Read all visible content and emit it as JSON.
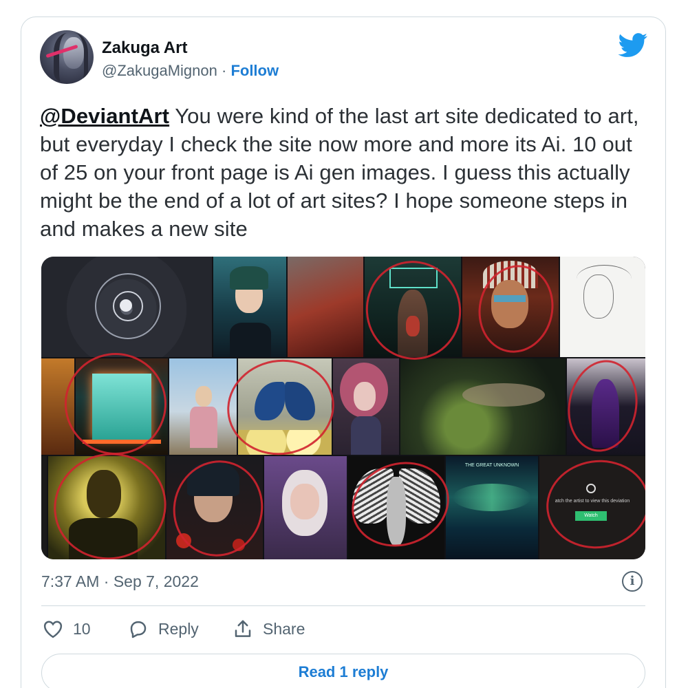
{
  "author": {
    "name": "Zakuga Art",
    "handle": "@ZakugaMignon",
    "separator": " · ",
    "follow_label": "Follow"
  },
  "tweet": {
    "mention": "@DeviantArt",
    "body": " You were kind of the last art site dedicated to art, but everyday I check the site now more and more its Ai. 10 out of 25 on your front page is Ai gen images. I guess this actually might be the end of a lot of art sites? I hope someone steps in and makes a new site"
  },
  "media": {
    "description_icon": "image-collage",
    "overlay_text": "atch the artist to view this deviation",
    "overlay_button": "Watch",
    "card_title": "THE GREAT UNKNOWN"
  },
  "meta": {
    "timestamp": "7:37 AM · Sep 7, 2022",
    "info_icon": "i"
  },
  "actions": {
    "like_count": "10",
    "reply_label": "Reply",
    "share_label": "Share"
  },
  "read_replies_label": "Read 1 reply",
  "colors": {
    "accent": "#1d9bf0",
    "link": "#1d7dd4",
    "muted": "#536471",
    "border": "#cfd9de",
    "annotation_red": "#d0232f"
  }
}
